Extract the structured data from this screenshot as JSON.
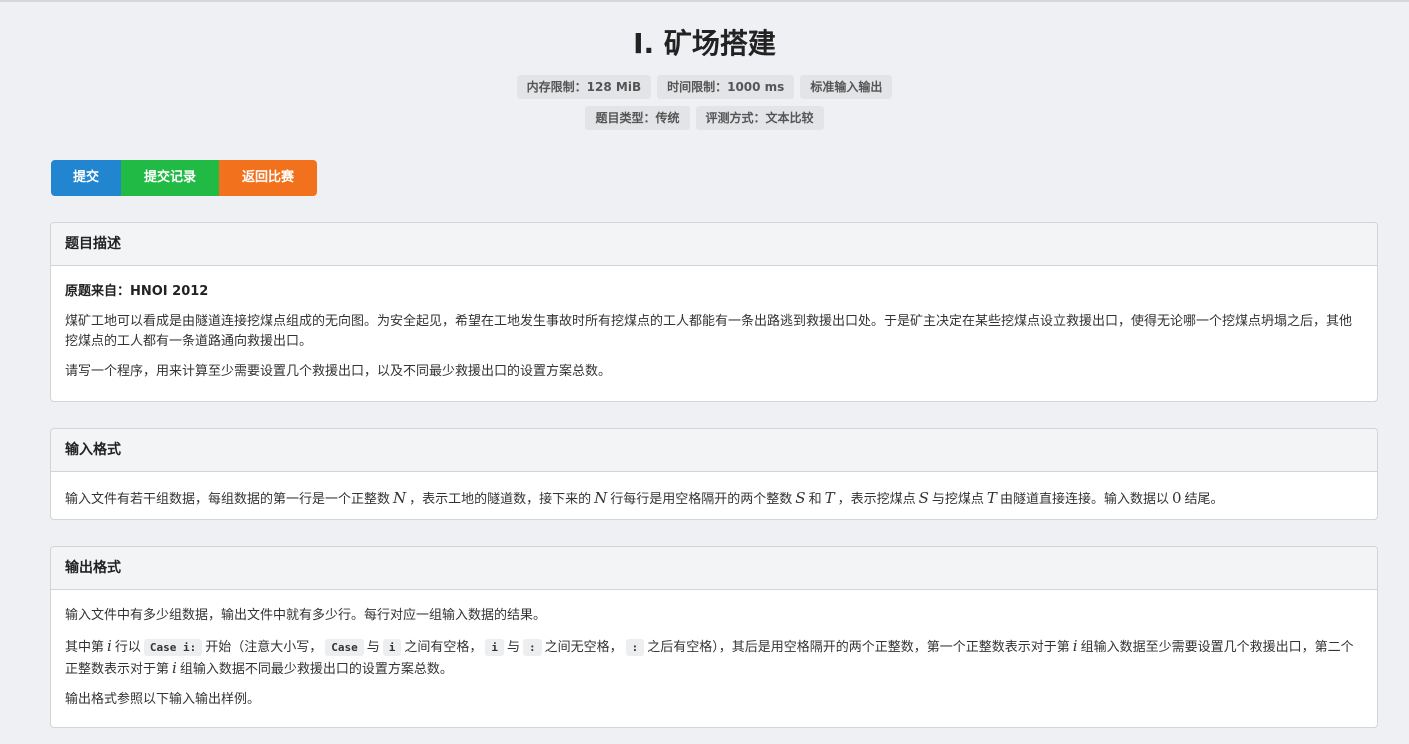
{
  "problem": {
    "title": "I. 矿场搭建"
  },
  "labels": {
    "memory": "内存限制：128 MiB",
    "time": "时间限制：1000 ms",
    "io": "标准输入输出",
    "type": "题目类型：传统",
    "judge": "评测方式：文本比较"
  },
  "buttons": {
    "submit": "提交",
    "records": "提交记录",
    "back": "返回比赛"
  },
  "description": {
    "heading": "题目描述",
    "source": "原题来自：HNOI 2012",
    "p1": "煤矿工地可以看成是由隧道连接挖煤点组成的无向图。为安全起见，希望在工地发生事故时所有挖煤点的工人都能有一条出路逃到救援出口处。于是矿主决定在某些挖煤点设立救援出口，使得无论哪一个挖煤点坍塌之后，其他挖煤点的工人都有一条道路通向救援出口。",
    "p2": "请写一个程序，用来计算至少需要设置几个救援出口，以及不同最少救援出口的设置方案总数。"
  },
  "input_format": {
    "heading": "输入格式",
    "t1": "输入文件有若干组数据，每组数据的第一行是一个正整数",
    "m_N1": "N",
    "t2": "，表示工地的隧道数，接下来的",
    "m_N2": "N",
    "t3": "行每行是用空格隔开的两个整数",
    "m_S1": "S",
    "t4": "和",
    "m_T1": "T",
    "t5": "，表示挖煤点",
    "m_S2": "S",
    "t6": "与挖煤点",
    "m_T2": "T",
    "t7": "由隧道直接连接。输入数据以",
    "m_0": "0",
    "t8": "结尾。"
  },
  "output_format": {
    "heading": "输出格式",
    "p1": "输入文件中有多少组数据，输出文件中就有多少行。每行对应一组输入数据的结果。",
    "q1": "其中第",
    "m_i1": "i",
    "q2": "行以",
    "c_case_i": "Case i:",
    "q3": "开始（注意大小写，",
    "c_case": "Case",
    "q4": "与",
    "c_i": "i",
    "q5": "之间有空格，",
    "c_i2": "i",
    "q6": "与",
    "c_colon": ":",
    "q7": "之间无空格，",
    "c_colon2": ":",
    "q8": "之后有空格），其后是用空格隔开的两个正整数，第一个正整数表示对于第",
    "m_i2": "i",
    "q9": "组输入数据至少需要设置几个救援出口，第二个正整数表示对于第",
    "m_i3": "i",
    "q10": "组输入数据不同最少救援出口的设置方案总数。",
    "p3": "输出格式参照以下输入输出样例。"
  }
}
